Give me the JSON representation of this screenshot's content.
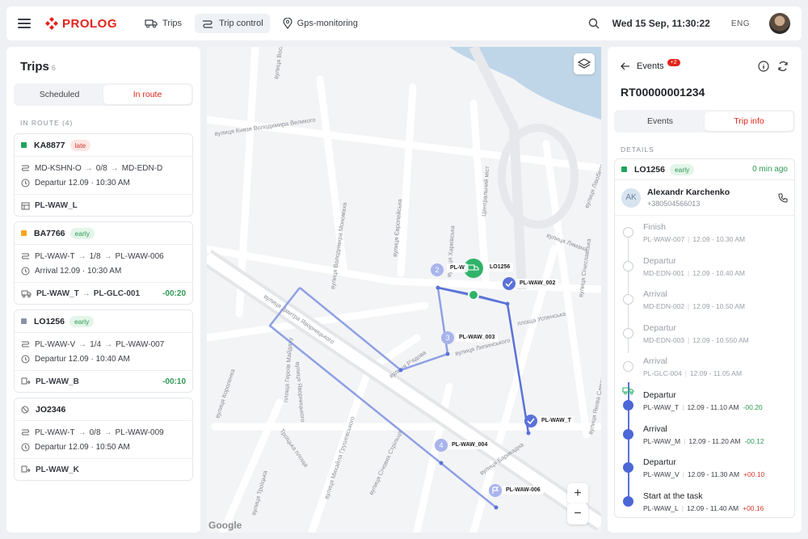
{
  "topbar": {
    "brand": "PROLOG",
    "nav": [
      {
        "label": "Trips",
        "icon": "truck-icon"
      },
      {
        "label": "Trip control",
        "icon": "route-icon",
        "active": true
      },
      {
        "label": "Gps-monitoring",
        "icon": "map-pin-icon"
      }
    ],
    "datetime": "Wed 15 Sep, 11:30:22",
    "language": "ENG"
  },
  "trips": {
    "title": "Trips",
    "count": "6",
    "tabs": [
      {
        "label": "Scheduled"
      },
      {
        "label": "In route",
        "active": true
      }
    ],
    "section": "IN ROUTE (4)",
    "cards": [
      {
        "id": "KA8877",
        "status": "late",
        "status_color": "#21a45a",
        "route_from": "MD-KSHN-O",
        "progress": "0/8",
        "route_to": "MD-EDN-D",
        "time_label": "Departur 12.09 · 10:30 AM",
        "foot": "PL-WAW_L",
        "delta": ""
      },
      {
        "id": "BA7766",
        "status": "early",
        "status_color": "#f5a623",
        "route_from": "PL-WAW-T",
        "progress": "1/8",
        "route_to": "PL-WAW-006",
        "time_label": "Arrival 12.09 · 10:30 AM",
        "foot_from": "PL-WAW_T",
        "foot_to": "PL-GLC-001",
        "delta": "-00:20"
      },
      {
        "id": "LO1256",
        "status": "early",
        "status_color": "#8a93a6",
        "route_from": "PL-WAW-V",
        "progress": "1/4",
        "route_to": "PL-WAW-007",
        "time_label": "Departur 12.09 · 10:40 AM",
        "foot": "PL-WAW_B",
        "delta": "-00:10"
      },
      {
        "id": "JO2346",
        "status": "",
        "route_from": "PL-WAW-T",
        "progress": "0/8",
        "route_to": "PL-WAW-009",
        "time_label": "Departur 12.09 · 10:50 AM",
        "foot": "PL-WAW_K",
        "delta": ""
      }
    ]
  },
  "map": {
    "streets": [
      "вулиця Воскресенська",
      "вулиця Князя Володимира Великого",
      "вулиця Володимира Мономаха",
      "вулиця Європейська",
      "вулиця Харківська",
      "Центральний міст",
      "вулиця Лівобережна",
      "вулиця Лямана",
      "вулиця Січеславська",
      "вулиця Дмитра Яворницького",
      "площа Успенська",
      "вулиця Р'ядова",
      "вулиця Липинського",
      "вулиця Яворницького",
      "площа Героїв Майдану",
      "вулиця Михайла Грушевського",
      "вулиця Троїцька",
      "Троїцька площа",
      "вулиця Січових Стрільців",
      "вулиця Барикадна",
      "вулиця Короленка",
      "вулиця Якова Самарського"
    ],
    "vehicle_label": "LO1256",
    "stops": [
      {
        "label": "PL-WAW_002",
        "kind": "check"
      },
      {
        "label": "PL-WAW_003",
        "kind": "number",
        "n": "3"
      },
      {
        "label": "PL-WAW_004",
        "kind": "number",
        "n": "4"
      },
      {
        "label": "PL-WAW-006",
        "kind": "flag"
      },
      {
        "label": "PL-WAW_T",
        "kind": "check"
      }
    ],
    "stop2": "2",
    "stop2_label": "PL-W",
    "route_color": "#5a72d8",
    "zoom_in": "+",
    "zoom_out": "−",
    "attribution": "Google"
  },
  "details": {
    "back_label": "Events",
    "event_badge": "+2",
    "trip_id": "RT00000001234",
    "tabs": [
      {
        "label": "Events"
      },
      {
        "label": "Trip info",
        "active": true
      }
    ],
    "section": "DETAILS",
    "vehicle": "LO1256",
    "vehicle_status": "early",
    "updated": "0 min ago",
    "driver": {
      "initials": "AK",
      "name": "Alexandr Karchenko",
      "phone": "+380504566013"
    },
    "events": [
      {
        "title": "Finish",
        "stop": "PL-WAW-007",
        "time": "12.09 - 10.30 AM",
        "delta": "",
        "done": false
      },
      {
        "title": "Departur",
        "stop": "MD-EDN-001",
        "time": "12.09 - 10.40 AM",
        "delta": "",
        "done": false
      },
      {
        "title": "Arrival",
        "stop": "MD-EDN-002",
        "time": "12.09 - 10.50 AM",
        "delta": "",
        "done": false
      },
      {
        "title": "Departur",
        "stop": "MD-EDN-003",
        "time": "12.09 - 10.550 AM",
        "delta": "",
        "done": false
      },
      {
        "title": "Arrival",
        "stop": "PL-GLC-004",
        "time": "12.09 - 11.05 AM",
        "delta": "",
        "done": false
      },
      {
        "title": "Departur",
        "stop": "PL-WAW_T",
        "time": "12.09 - 11.10 AM",
        "delta": "-00.20",
        "done": true
      },
      {
        "title": "Arrival",
        "stop": "PL-WAW_M",
        "time": "12.09 - 11.20 AM",
        "delta": "-00.12",
        "done": true
      },
      {
        "title": "Departur",
        "stop": "PL-WAW_V",
        "time": "12.09 - 11.30 AM",
        "delta": "+00.10",
        "done": true
      },
      {
        "title": "Start at the task",
        "stop": "PL-WAW_L",
        "time": "12.09 - 11.40 AM",
        "delta": "+00.16",
        "done": true
      }
    ]
  }
}
